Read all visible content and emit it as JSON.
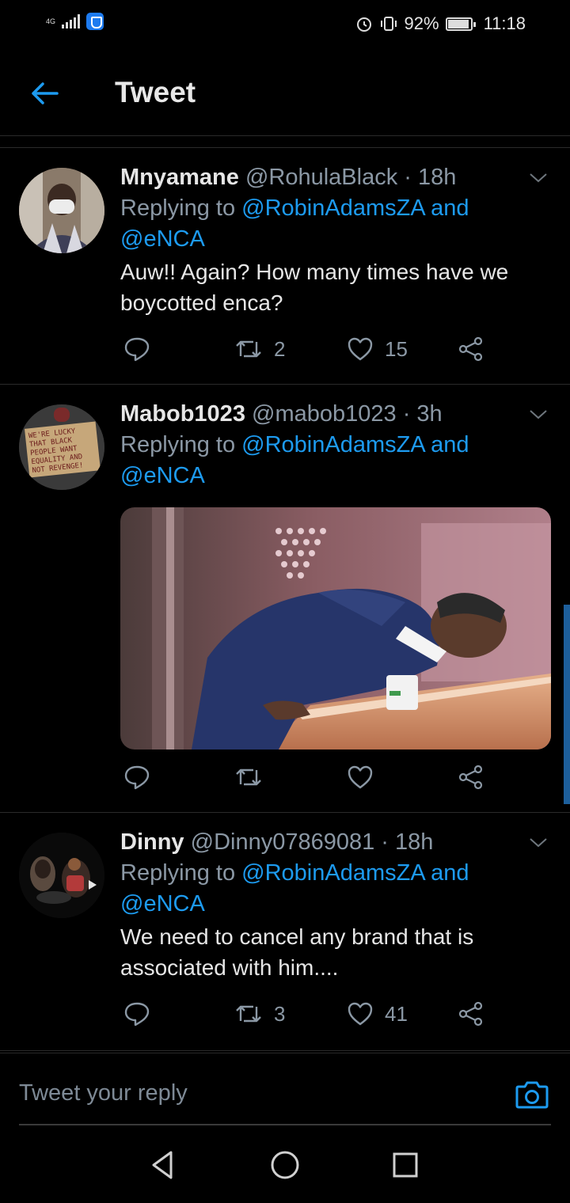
{
  "status_bar": {
    "network": "4G",
    "battery_percent": "92%",
    "time": "11:18"
  },
  "header": {
    "title": "Tweet"
  },
  "tweets": [
    {
      "name": "Mnyamane",
      "handle": "@RohulaBlack",
      "time": "· 18h",
      "replying_prefix": "Replying to ",
      "replying_to": "@RobinAdamsZA and",
      "replying_to_2": "@eNCA",
      "text": "Auw!! Again? How many times have we boycotted enca?",
      "retweets": "2",
      "likes": "15"
    },
    {
      "name": "Mabob1023",
      "handle": "@mabob1023",
      "time": "· 3h",
      "replying_prefix": "Replying to ",
      "replying_to": "@RobinAdamsZA and",
      "replying_to_2": "@eNCA",
      "text": "",
      "retweets": "",
      "likes": "",
      "avatar_sign": [
        "WE'RE LUCKY",
        "THAT BLACK",
        "PEOPLE WANT",
        "EQUALITY AND",
        "NOT REVENGE!"
      ]
    },
    {
      "name": "Dinny",
      "handle": "@Dinny07869081",
      "time": "· 18h",
      "replying_prefix": "Replying to ",
      "replying_to": "@RobinAdamsZA and",
      "replying_to_2": "@eNCA",
      "text": "We need to cancel any brand that is associated with him....",
      "retweets": "3",
      "likes": "41"
    }
  ],
  "composer": {
    "placeholder": "Tweet your reply"
  },
  "colors": {
    "accent": "#1d9bf0",
    "muted": "#8b98a5",
    "background": "#000000"
  },
  "icons": [
    "back-arrow-icon",
    "chevron-down-icon",
    "reply-icon",
    "retweet-icon",
    "like-icon",
    "share-icon",
    "camera-icon",
    "nav-back-icon",
    "nav-home-icon",
    "nav-recents-icon"
  ]
}
